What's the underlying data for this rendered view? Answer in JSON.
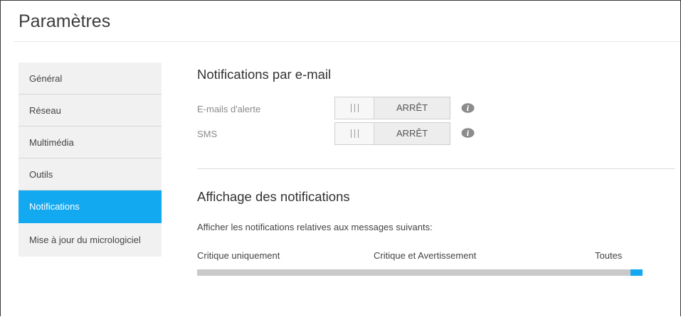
{
  "page": {
    "title": "Paramètres"
  },
  "sidebar": {
    "items": [
      {
        "label": "Général"
      },
      {
        "label": "Réseau"
      },
      {
        "label": "Multimédia"
      },
      {
        "label": "Outils"
      },
      {
        "label": "Notifications",
        "active": true
      },
      {
        "label": "Mise à jour du micrologiciel"
      }
    ]
  },
  "email_section": {
    "title": "Notifications par e-mail",
    "alert_emails": {
      "label": "E-mails d'alerte",
      "state": "ARRÊT"
    },
    "sms": {
      "label": "SMS",
      "state": "ARRÊT"
    },
    "info_icon": "info-icon"
  },
  "display_section": {
    "title": "Affichage des notifications",
    "description": "Afficher les notifications relatives aux messages suivants:",
    "levels": [
      "Critique uniquement",
      "Critique et Avertissement",
      "Toutes"
    ],
    "selected": "Toutes"
  },
  "colors": {
    "accent": "#12a9f0",
    "sidebar_bg": "#f1f1f1",
    "track": "#c9c9c9"
  }
}
